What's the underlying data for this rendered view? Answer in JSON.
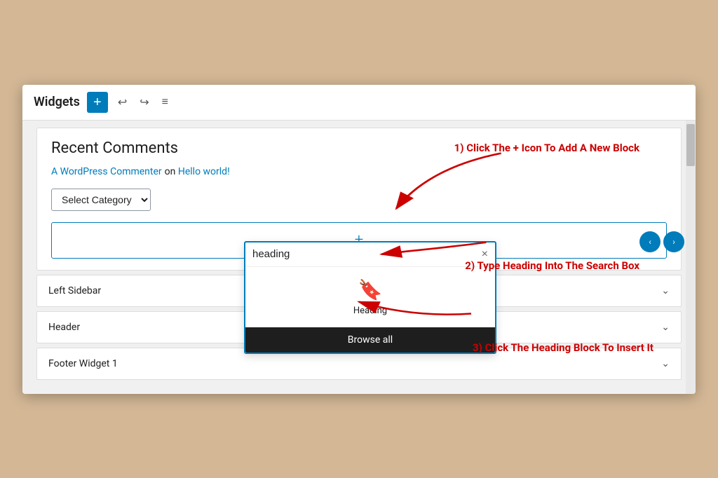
{
  "header": {
    "title": "Widgets",
    "add_btn_label": "+",
    "undo_icon": "↩",
    "redo_icon": "↪",
    "menu_icon": "≡"
  },
  "widget": {
    "recent_comments_title": "Recent Comments",
    "commenter_link": "A WordPress Commenter",
    "commenter_on": " on ",
    "commenter_post": "Hello world!",
    "select_category_label": "Select Category"
  },
  "block_adder": {
    "plus": "+"
  },
  "search_popup": {
    "input_value": "heading",
    "clear_btn": "×",
    "block_icon": "🔖",
    "block_label": "Heading",
    "browse_all": "Browse all"
  },
  "sidebar_items": [
    {
      "label": "Left Sidebar"
    },
    {
      "label": "Header"
    },
    {
      "label": "Footer Widget 1"
    }
  ],
  "annotations": {
    "ann1": "1) Click The + Icon To Add A New Block",
    "ann2": "2) Type Heading Into The Search Box",
    "ann3": "3) Click The Heading Block To Insert It"
  }
}
